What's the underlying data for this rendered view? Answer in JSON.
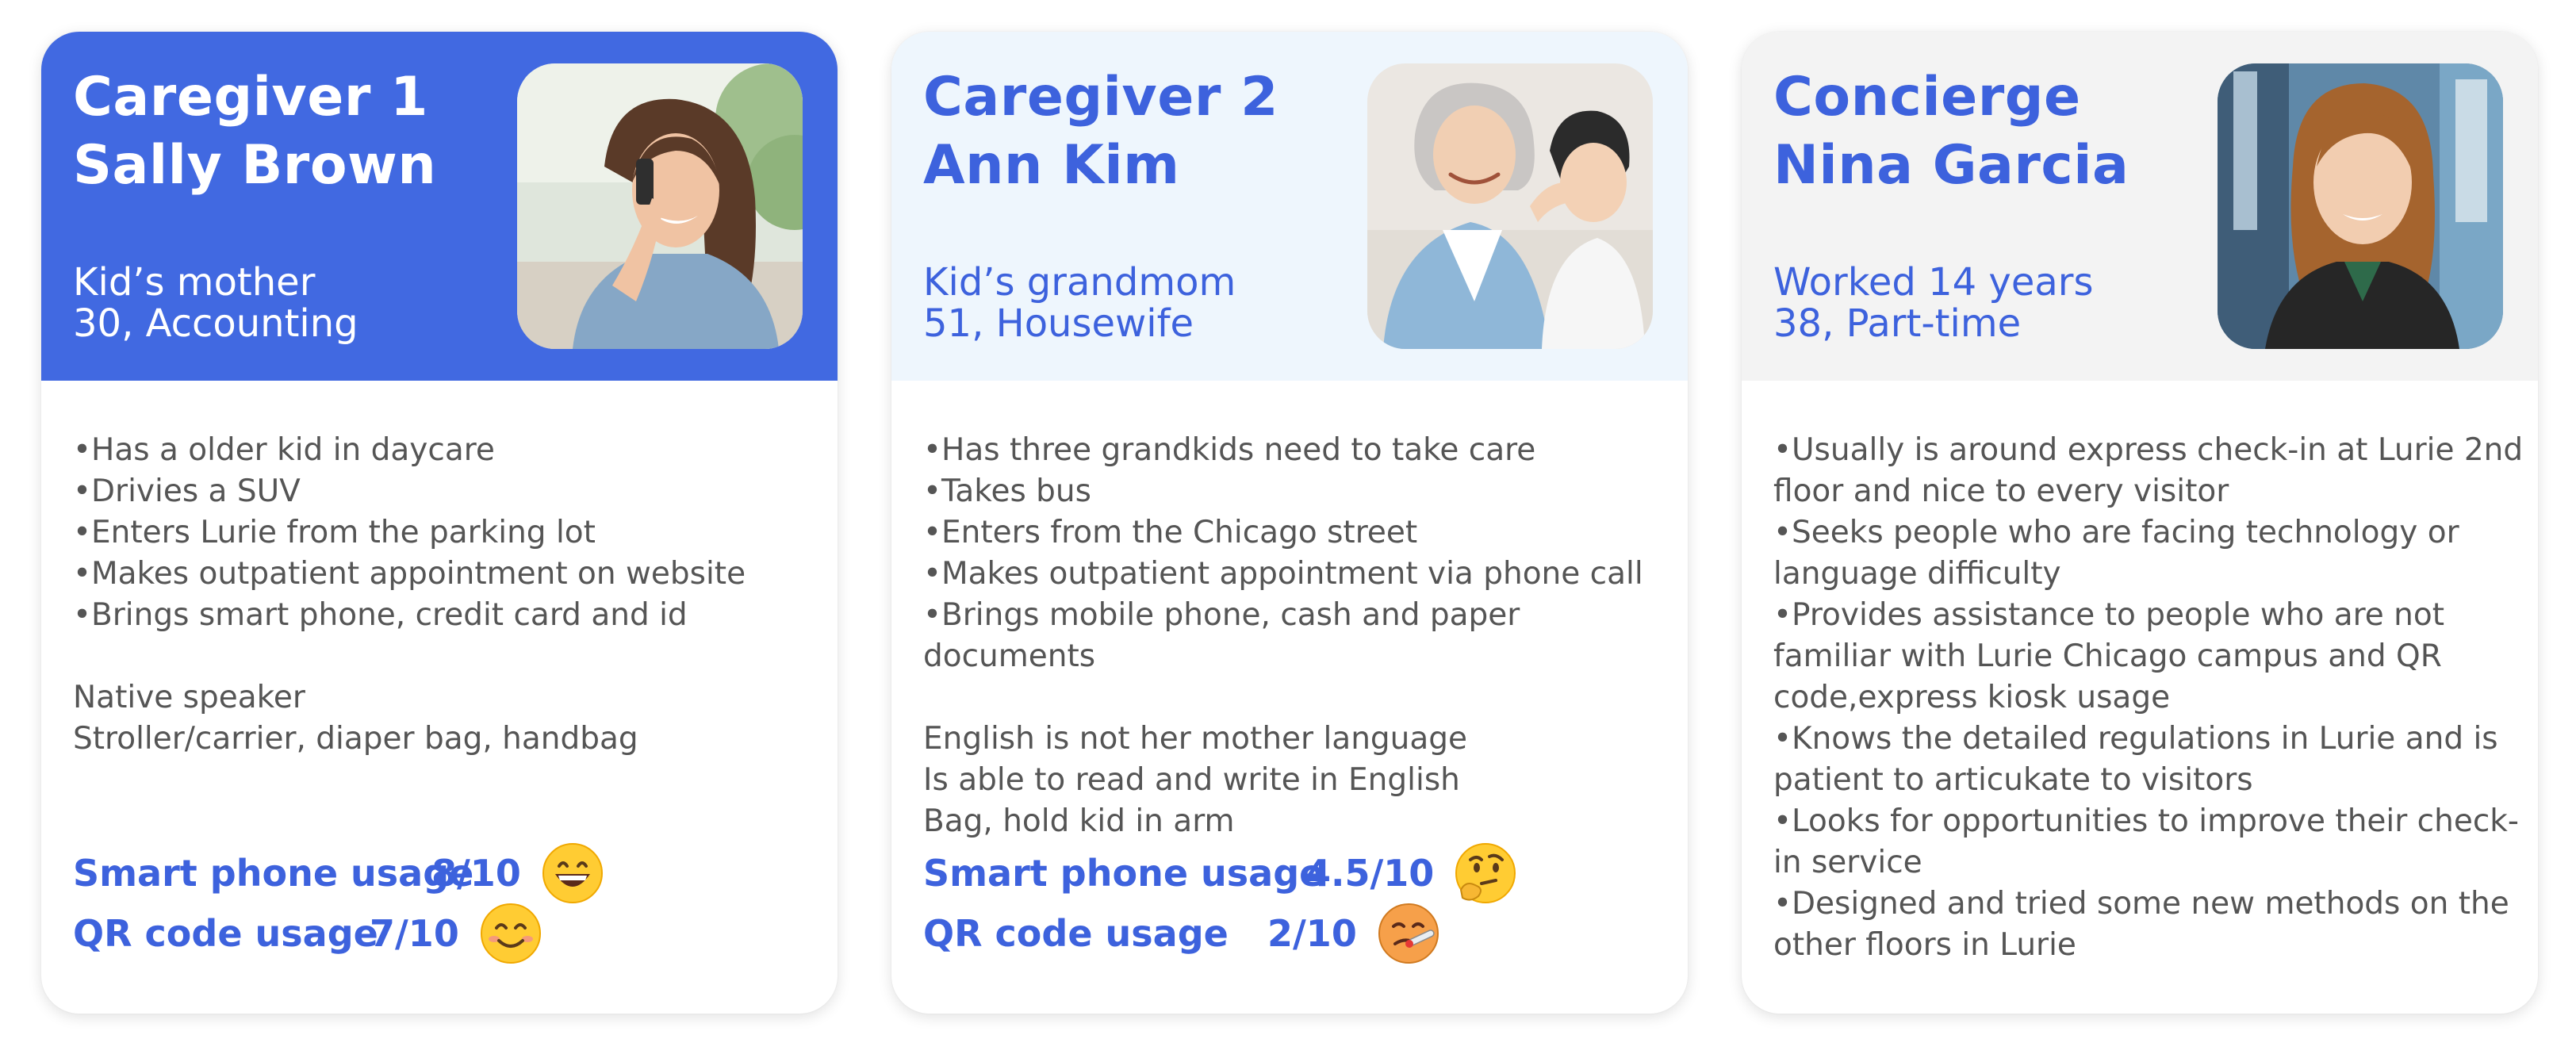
{
  "cards": [
    {
      "title": [
        "Caregiver 1",
        "Sally Brown"
      ],
      "subtitle": [
        "Kid’s mother",
        "30, Accounting"
      ],
      "photo_icon": "woman-on-phone-photo",
      "bullets": [
        "•Has a older kid in daycare",
        "•Drivies a SUV",
        "•Enters Lurie from the parking lot",
        "•Makes outpatient appointment on website",
        "•Brings smart phone, credit card and id"
      ],
      "notes": [
        "Native speaker",
        "Stroller/carrier, diaper bag, handbag"
      ],
      "usage": [
        {
          "label": "Smart phone usage",
          "score": "8/10",
          "emoji": "grinning-face-icon"
        },
        {
          "label": "QR code usage",
          "score": "7/10",
          "emoji": "smiling-face-icon"
        }
      ]
    },
    {
      "title": [
        "Caregiver 2",
        "Ann Kim"
      ],
      "subtitle": [
        "Kid’s grandmom",
        "51, Housewife"
      ],
      "photo_icon": "grandmother-and-child-photo",
      "bullets": [
        "•Has three grandkids need to take care",
        "•Takes bus",
        "•Enters from the Chicago street",
        "•Makes outpatient appointment via phone call",
        "•Brings mobile phone, cash and paper",
        "documents"
      ],
      "notes": [
        "English is not her mother language",
        "Is able to read and write in English",
        "Bag, hold kid in arm"
      ],
      "usage": [
        {
          "label": "Smart phone usage",
          "score": "4.5/10",
          "emoji": "thinking-face-icon"
        },
        {
          "label": "QR code usage",
          "score": "2/10",
          "emoji": "face-with-thermometer-icon"
        }
      ]
    },
    {
      "title": [
        "Concierge",
        "Nina Garcia"
      ],
      "subtitle": [
        "Worked 14 years",
        "38, Part-time"
      ],
      "photo_icon": "businesswoman-portrait-photo",
      "bullets": [
        "•Usually is around express check-in at Lurie 2nd",
        "floor and nice to every visitor",
        "•Seeks people who are facing technology or",
        "language difficulty",
        "•Provides assistance to people who are not",
        "familiar with Lurie Chicago campus and QR",
        "code,express kiosk usage",
        "•Knows the detailed regulations in Lurie and is",
        "patient to articukate to visitors",
        "•Looks for opportunities to improve their check-",
        "in service",
        "•Designed and tried some new methods on the",
        "other floors in Lurie"
      ],
      "notes": [],
      "usage": []
    }
  ],
  "colors": {
    "accent_blue": "#4169e1",
    "title_blue": "#3d62dd",
    "header_light_blue": "#eef6fd",
    "header_light_gray": "#f3f3f3",
    "body_text": "#555555"
  }
}
